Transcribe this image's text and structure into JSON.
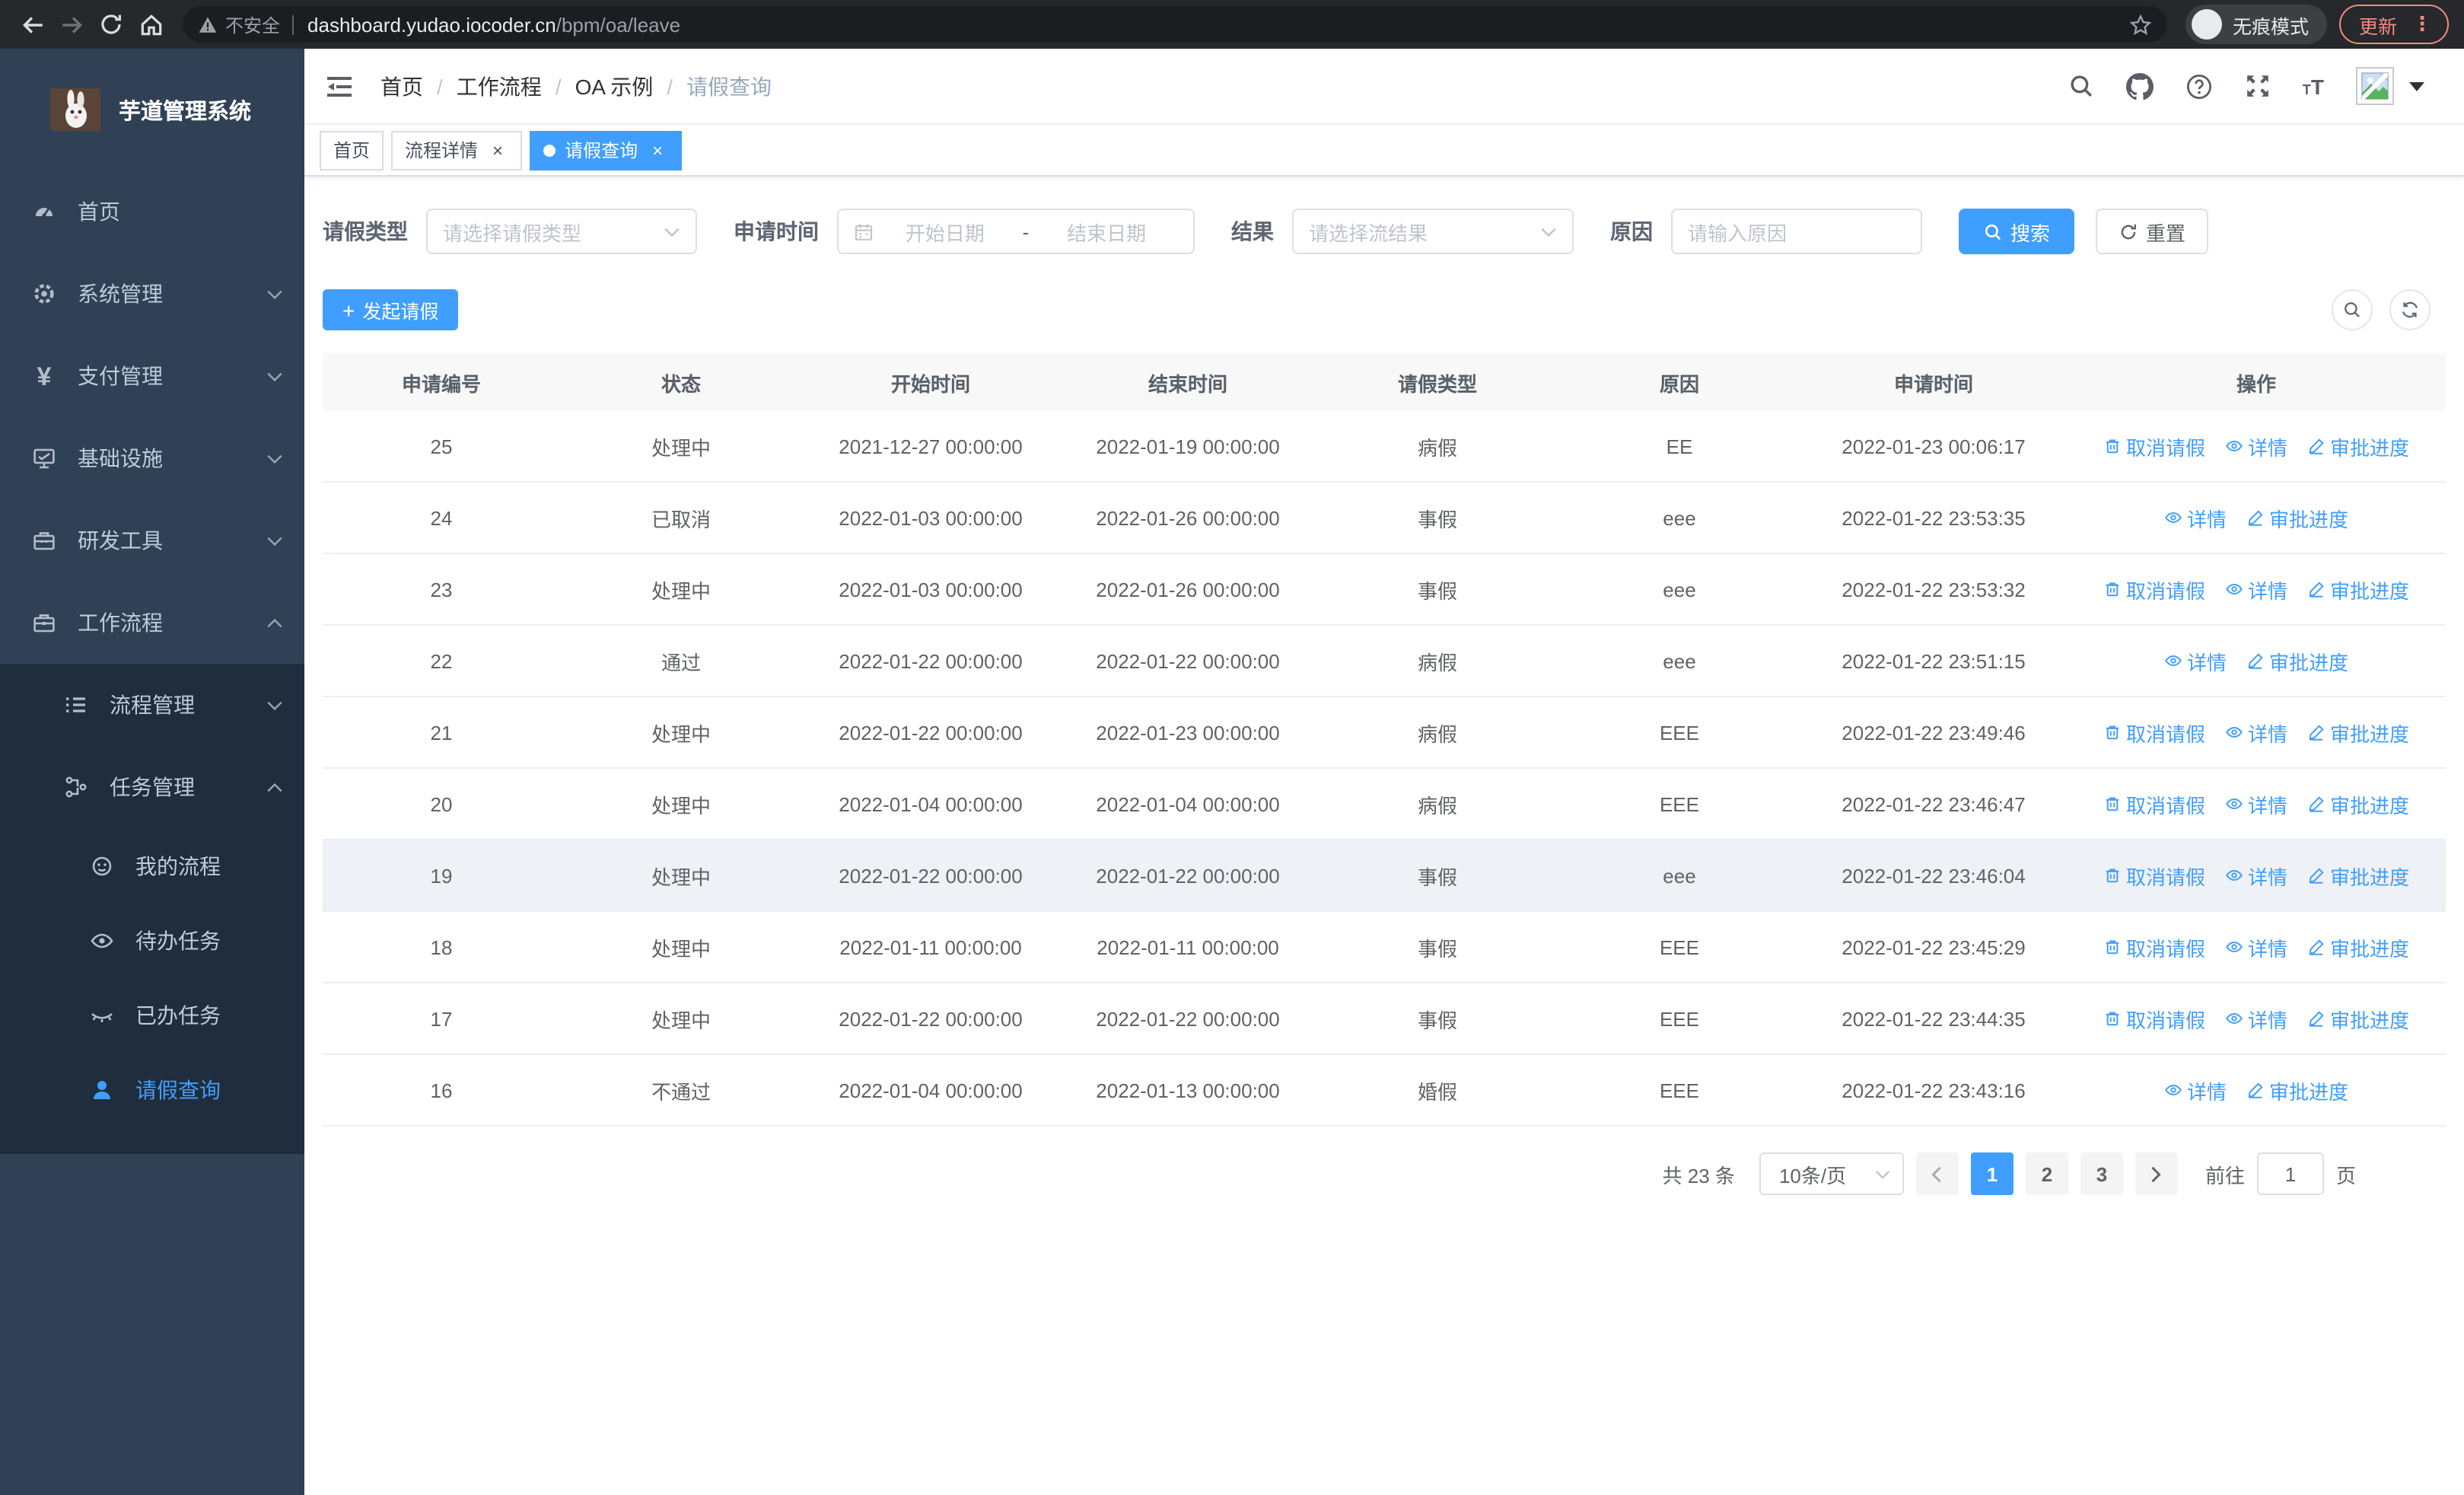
{
  "browser": {
    "security_label": "不安全",
    "url_host": "dashboard.yudao.iocoder.cn",
    "url_path": "/bpm/oa/leave",
    "incognito_label": "无痕模式",
    "update_label": "更新"
  },
  "sidebar": {
    "title": "芋道管理系统",
    "items": [
      {
        "key": "home",
        "label": "首页",
        "icon": "dashboard-icon",
        "level": 1
      },
      {
        "key": "system",
        "label": "系统管理",
        "icon": "gear-icon",
        "level": 1,
        "chevron": "down"
      },
      {
        "key": "payment",
        "label": "支付管理",
        "icon": "yen-icon",
        "level": 1,
        "chevron": "down"
      },
      {
        "key": "infra",
        "label": "基础设施",
        "icon": "monitor-icon",
        "level": 1,
        "chevron": "down"
      },
      {
        "key": "devtools",
        "label": "研发工具",
        "icon": "toolbox-icon",
        "level": 1,
        "chevron": "down"
      },
      {
        "key": "workflow",
        "label": "工作流程",
        "icon": "briefcase-icon",
        "level": 1,
        "chevron": "up"
      }
    ],
    "submenu": [
      {
        "key": "process-mgmt",
        "label": "流程管理",
        "icon": "list-icon",
        "level": 2,
        "chevron": "down"
      },
      {
        "key": "task-mgmt",
        "label": "任务管理",
        "icon": "flow-icon",
        "level": 2,
        "chevron": "up"
      },
      {
        "key": "my-process",
        "label": "我的流程",
        "icon": "face-icon",
        "level": 3
      },
      {
        "key": "todo-tasks",
        "label": "待办任务",
        "icon": "eye-icon",
        "level": 3
      },
      {
        "key": "done-tasks",
        "label": "已办任务",
        "icon": "eye-closed-icon",
        "level": 3
      },
      {
        "key": "leave-query",
        "label": "请假查询",
        "icon": "user-icon",
        "level": 3,
        "active": true
      }
    ]
  },
  "header": {
    "breadcrumb": [
      "首页",
      "工作流程",
      "OA 示例",
      "请假查询"
    ]
  },
  "tabs": [
    {
      "label": "首页",
      "closable": false,
      "active": false
    },
    {
      "label": "流程详情",
      "closable": true,
      "active": false
    },
    {
      "label": "请假查询",
      "closable": true,
      "active": true
    }
  ],
  "filters": {
    "leave_type_label": "请假类型",
    "leave_type_placeholder": "请选择请假类型",
    "apply_time_label": "申请时间",
    "start_placeholder": "开始日期",
    "range_separator": "-",
    "end_placeholder": "结束日期",
    "result_label": "结果",
    "result_placeholder": "请选择流结果",
    "reason_label": "原因",
    "reason_placeholder": "请输入原因",
    "search_label": "搜索",
    "reset_label": "重置"
  },
  "toolbar": {
    "create_label": "发起请假"
  },
  "table": {
    "columns": [
      "申请编号",
      "状态",
      "开始时间",
      "结束时间",
      "请假类型",
      "原因",
      "申请时间",
      "操作"
    ],
    "action_labels": {
      "cancel": "取消请假",
      "detail": "详情",
      "progress": "审批进度"
    },
    "rows": [
      {
        "id": "25",
        "status": "处理中",
        "start": "2021-12-27 00:00:00",
        "end": "2022-01-19 00:00:00",
        "type": "病假",
        "reason": "EE",
        "applied": "2022-01-23 00:06:17",
        "actions": [
          "cancel",
          "detail",
          "progress"
        ]
      },
      {
        "id": "24",
        "status": "已取消",
        "start": "2022-01-03 00:00:00",
        "end": "2022-01-26 00:00:00",
        "type": "事假",
        "reason": "eee",
        "applied": "2022-01-22 23:53:35",
        "actions": [
          "detail",
          "progress"
        ]
      },
      {
        "id": "23",
        "status": "处理中",
        "start": "2022-01-03 00:00:00",
        "end": "2022-01-26 00:00:00",
        "type": "事假",
        "reason": "eee",
        "applied": "2022-01-22 23:53:32",
        "actions": [
          "cancel",
          "detail",
          "progress"
        ]
      },
      {
        "id": "22",
        "status": "通过",
        "start": "2022-01-22 00:00:00",
        "end": "2022-01-22 00:00:00",
        "type": "病假",
        "reason": "eee",
        "applied": "2022-01-22 23:51:15",
        "actions": [
          "detail",
          "progress"
        ]
      },
      {
        "id": "21",
        "status": "处理中",
        "start": "2022-01-22 00:00:00",
        "end": "2022-01-23 00:00:00",
        "type": "病假",
        "reason": "EEE",
        "applied": "2022-01-22 23:49:46",
        "actions": [
          "cancel",
          "detail",
          "progress"
        ]
      },
      {
        "id": "20",
        "status": "处理中",
        "start": "2022-01-04 00:00:00",
        "end": "2022-01-04 00:00:00",
        "type": "病假",
        "reason": "EEE",
        "applied": "2022-01-22 23:46:47",
        "actions": [
          "cancel",
          "detail",
          "progress"
        ]
      },
      {
        "id": "19",
        "status": "处理中",
        "start": "2022-01-22 00:00:00",
        "end": "2022-01-22 00:00:00",
        "type": "事假",
        "reason": "eee",
        "applied": "2022-01-22 23:46:04",
        "actions": [
          "cancel",
          "detail",
          "progress"
        ],
        "highlight": true
      },
      {
        "id": "18",
        "status": "处理中",
        "start": "2022-01-11 00:00:00",
        "end": "2022-01-11 00:00:00",
        "type": "事假",
        "reason": "EEE",
        "applied": "2022-01-22 23:45:29",
        "actions": [
          "cancel",
          "detail",
          "progress"
        ]
      },
      {
        "id": "17",
        "status": "处理中",
        "start": "2022-01-22 00:00:00",
        "end": "2022-01-22 00:00:00",
        "type": "事假",
        "reason": "EEE",
        "applied": "2022-01-22 23:44:35",
        "actions": [
          "cancel",
          "detail",
          "progress"
        ]
      },
      {
        "id": "16",
        "status": "不通过",
        "start": "2022-01-04 00:00:00",
        "end": "2022-01-13 00:00:00",
        "type": "婚假",
        "reason": "EEE",
        "applied": "2022-01-22 23:43:16",
        "actions": [
          "detail",
          "progress"
        ]
      }
    ]
  },
  "pagination": {
    "total_label": "共 23 条",
    "page_size_label": "10条/页",
    "pages": [
      "1",
      "2",
      "3"
    ],
    "active_page": "1",
    "goto_label": "前往",
    "goto_value": "1",
    "page_unit_label": "页"
  },
  "colors": {
    "primary": "#409eff",
    "sidebar_bg": "#304156",
    "submenu_bg": "#1f2d3d",
    "update_accent": "#f28b82"
  }
}
